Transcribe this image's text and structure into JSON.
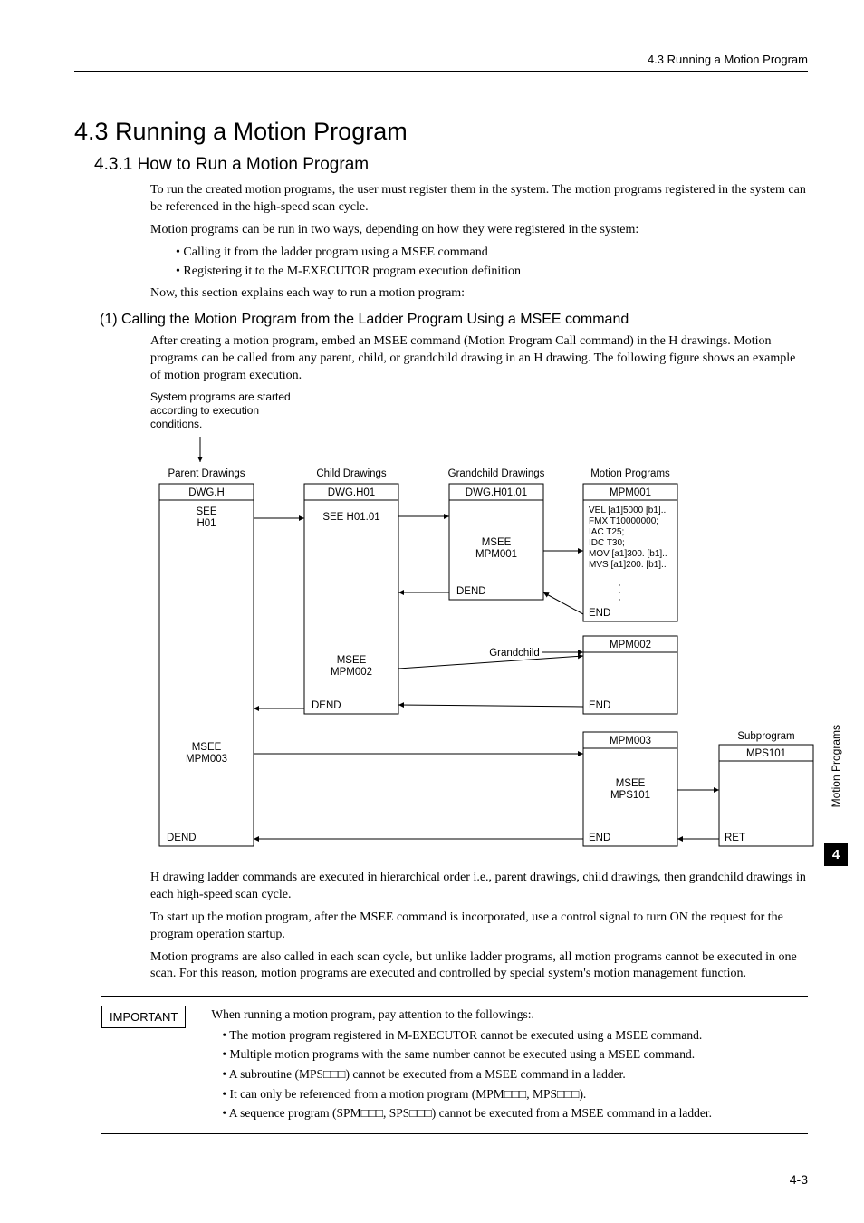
{
  "header": {
    "right": "4.3  Running a Motion Program"
  },
  "h1": "4.3  Running a Motion Program",
  "h2": "4.3.1  How to Run a Motion Program",
  "p1": "To run the created motion programs, the user must register them in the system. The motion programs registered in the system can be referenced in the high-speed scan cycle.",
  "p2": "Motion programs can be run in two ways, depending on how they were registered in the system:",
  "bullets1": [
    "Calling it from the ladder program using a MSEE command",
    "Registering it to the M-EXECUTOR program execution definition"
  ],
  "p3": "Now, this section explains each way to run a motion program:",
  "h3": "(1) Calling the Motion Program from the Ladder Program Using a MSEE command",
  "p4": "After creating a motion program, embed an MSEE command (Motion Program Call command) in the H drawings. Motion programs can be called from any parent, child, or grandchild drawing in an H drawing. The following figure shows an example of motion program execution.",
  "diag": {
    "note": "System programs are started according to execution conditions.",
    "col_headers": [
      "Parent Drawings",
      "Child Drawings",
      "Grandchild Drawings",
      "Motion Programs",
      "Subprogram"
    ],
    "parent": {
      "title": "DWG.H",
      "l1a": "SEE",
      "l1b": "H01",
      "msee": "MSEE",
      "mpm": "MPM003",
      "dend": "DEND"
    },
    "child": {
      "title": "DWG.H01",
      "see": "SEE H01.01",
      "msee": "MSEE",
      "mpm": "MPM002",
      "dend": "DEND"
    },
    "gchild": {
      "title": "DWG.H01.01",
      "msee": "MSEE",
      "mpm": "MPM001",
      "dend": "DEND",
      "label": "Grandchild"
    },
    "mp1": {
      "title": "MPM001",
      "lines": [
        "VEL [a1]5000 [b1]..",
        "FMX T10000000;",
        "IAC T25;",
        "IDC T30;",
        "MOV [a1]300. [b1]..",
        "MVS [a1]200. [b1].."
      ],
      "end": "END"
    },
    "mp2": {
      "title": "MPM002",
      "end": "END"
    },
    "mp3": {
      "title": "MPM003",
      "msee": "MSEE",
      "mps": "MPS101",
      "end": "END"
    },
    "sub": {
      "title": "MPS101",
      "ret": "RET"
    }
  },
  "p5": "H drawing ladder commands are executed in hierarchical order i.e., parent drawings, child drawings, then grandchild drawings in each high-speed scan cycle.",
  "p6": "To start up the motion program, after the MSEE command is incorporated, use a control signal to turn ON the request for the program operation startup.",
  "p7": "Motion programs are also called in each scan cycle, but unlike ladder programs, all motion programs cannot be executed in one scan. For this reason, motion programs are executed and controlled by special system's motion management function.",
  "important": {
    "label": "IMPORTANT",
    "intro": "When running a motion program, pay attention to the followings:.",
    "items": [
      "The motion program registered in M-EXECUTOR cannot be executed using a MSEE command.",
      "Multiple motion programs with the same number cannot be executed using a MSEE command.",
      "A subroutine (MPS□□□) cannot be executed from a MSEE command in a ladder.",
      "It can only be referenced from a motion program (MPM□□□, MPS□□□).",
      "A sequence program (SPM□□□, SPS□□□) cannot be executed from a MSEE command in a ladder."
    ]
  },
  "side": {
    "label": "Motion Programs",
    "chapter": "4"
  },
  "page": "4-3"
}
